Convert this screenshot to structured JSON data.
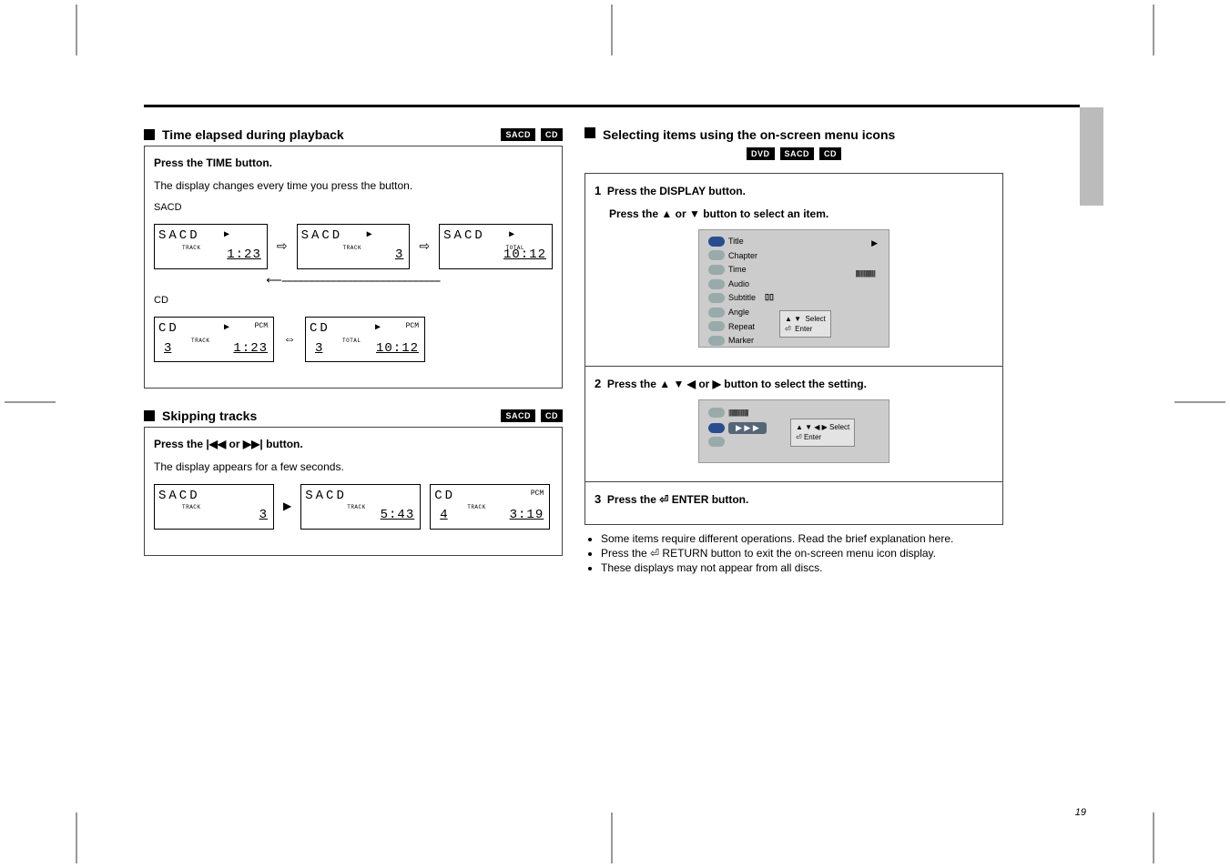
{
  "page_number": "19",
  "left": {
    "heading1_pre": "Time elapsed during playback ",
    "heading1_tags": [
      "SACD",
      "CD"
    ],
    "par1a": "Press the TIME button.",
    "par1b": "The display changes every time you press the button.",
    "sacd_label": "SACD",
    "disp_sacd": [
      {
        "type": "SACD",
        "play": "▶",
        "tiny": "TRACK",
        "tk": "",
        "val": "1:23"
      },
      {
        "type": "SACD",
        "play": "▶",
        "tiny": "TRACK",
        "tk": "",
        "val": "3"
      },
      {
        "type": "SACD",
        "play": "▶",
        "tiny": "TOTAL",
        "tk": "",
        "val": "10:12"
      }
    ],
    "loop_arrow": "⇧",
    "cd_label": "CD",
    "disp_cd": [
      {
        "type": "CD",
        "play": "▶",
        "pcm": "PCM",
        "tiny": "TRACK",
        "tk": "3",
        "val": "1:23"
      },
      {
        "type": "CD",
        "play": "▶",
        "pcm": "PCM",
        "tiny": "TOTAL",
        "tk": "3",
        "val": "10:12"
      }
    ],
    "heading2_pre": "Skipping tracks ",
    "heading2_tags": [
      "SACD",
      "CD"
    ],
    "par2a_pre": "Press the ",
    "par2a_glyph_prev": "|◀◀",
    "par2a_mid": " or ",
    "par2a_glyph_next": "▶▶|",
    "par2a_post": " button.",
    "par2b": "The display appears for a few seconds.",
    "disp_skip": [
      {
        "type": "SACD",
        "tiny": "TRACK",
        "val": "3"
      },
      {
        "type": "SACD",
        "tiny": "TRACK",
        "val": "5:43"
      },
      {
        "type": "CD",
        "pcm": "PCM",
        "tiny": "TRACK",
        "tk": "4",
        "val": "3:19"
      }
    ]
  },
  "right": {
    "heading_pre": "Selecting items using the on-screen menu icons",
    "heading_tags": [
      "DVD",
      "SACD",
      "CD"
    ],
    "step1_num": "1",
    "step1_a": "Press the DISPLAY button.",
    "step1_b_pre": "Press the ",
    "step1_b_mid": " or ",
    "step1_b_post": " button to select an item.",
    "menu_items": [
      "Title",
      "Chapter",
      "Time",
      "Audio",
      "Subtitle",
      "Angle",
      "Repeat",
      "Marker"
    ],
    "menu_hint1": "Select",
    "menu_hint2": "Enter",
    "barcode": "||||||||||||||||||||",
    "dolby_glyph": "▯▯",
    "step2_num": "2",
    "step2_txt_pre": "Press the ",
    "step2_txt_mid": " or ",
    "step2_txt_post": " button to select the setting.",
    "scr2_label": "▶ ▶ ▶",
    "scr2_hint1_pre": "▲ ▼ ◀ ▶",
    "scr2_hint2": "Enter",
    "step3_num": "3",
    "step3_txt_pre": "Press the ",
    "step3_txt_post": " ENTER button.",
    "bullets": [
      "Some items require different operations. Read the brief explanation here.",
      "Press the ⏎ RETURN button to exit the on-screen menu icon display.",
      "These displays may not appear from all discs."
    ]
  },
  "glyph": {
    "up": "▲",
    "down": "▼",
    "left": "◀",
    "right": "▶",
    "enter": "⏎",
    "bi": "⇔",
    "one": "⇨",
    "prev": "|◀◀",
    "next": "▶▶|"
  },
  "colors": {
    "accent": "#2a4d8f"
  }
}
